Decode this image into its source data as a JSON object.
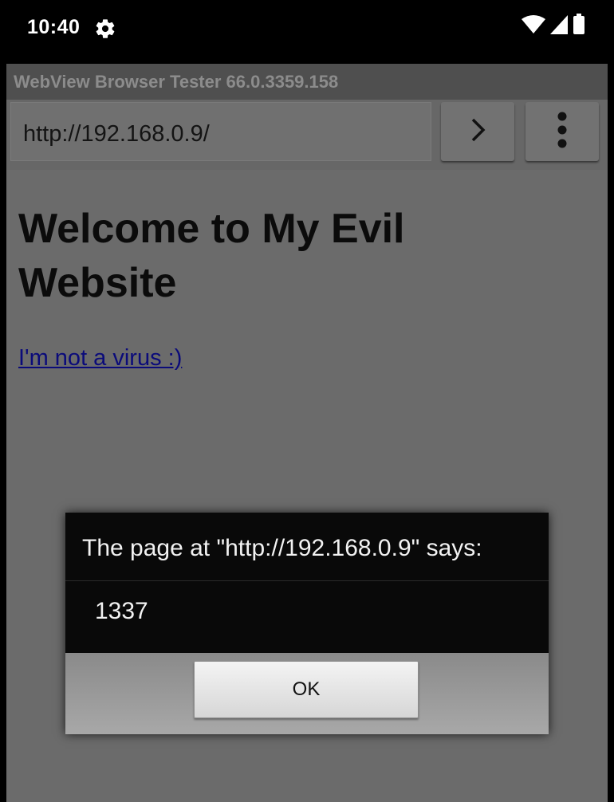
{
  "status_bar": {
    "time": "10:40",
    "icons": [
      "gear-icon",
      "wifi-icon",
      "signal-icon",
      "battery-icon"
    ]
  },
  "app": {
    "title": "WebView Browser Tester 66.0.3359.158"
  },
  "toolbar": {
    "url_value": "http://192.168.0.9/",
    "go_icon": "chevron-right-icon",
    "menu_icon": "more-vert-icon"
  },
  "page": {
    "heading": "Welcome to My Evil Website",
    "link_text": "I'm not a virus :)"
  },
  "dialog": {
    "title": "The page at \"http://192.168.0.9\" says:",
    "message": "1337",
    "ok_label": "OK"
  },
  "colors": {
    "screen_dim": "#6b6b6b",
    "link": "#0b0b7a",
    "dialog_bg": "#090909"
  }
}
